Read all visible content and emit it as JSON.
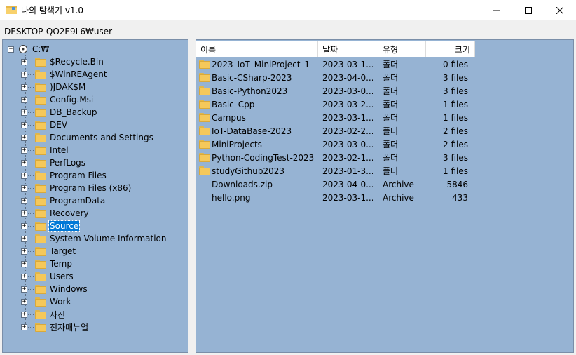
{
  "window": {
    "title": "나의 탐색기 v1.0",
    "minimize": "─",
    "maximize": "☐",
    "close": "✕"
  },
  "path": "DESKTOP-QO2E9L6₩user",
  "tree": {
    "root": "C:₩",
    "items": [
      {
        "label": "$Recycle.Bin"
      },
      {
        "label": "$WinREAgent"
      },
      {
        "label": ")JDAK$M"
      },
      {
        "label": "Config.Msi"
      },
      {
        "label": "DB_Backup"
      },
      {
        "label": "DEV"
      },
      {
        "label": "Documents and Settings"
      },
      {
        "label": "Intel"
      },
      {
        "label": "PerfLogs"
      },
      {
        "label": "Program Files"
      },
      {
        "label": "Program Files (x86)"
      },
      {
        "label": "ProgramData"
      },
      {
        "label": "Recovery"
      },
      {
        "label": "Source"
      },
      {
        "label": "System Volume Information"
      },
      {
        "label": "Target"
      },
      {
        "label": "Temp"
      },
      {
        "label": "Users"
      },
      {
        "label": "Windows"
      },
      {
        "label": "Work"
      },
      {
        "label": "사진"
      },
      {
        "label": "전자매뉴얼"
      }
    ],
    "selected": "Source"
  },
  "list": {
    "headers": {
      "name": "이름",
      "date": "날짜",
      "type": "유형",
      "size": "크기"
    },
    "rows": [
      {
        "name": "2023_IoT_MiniProject_1",
        "date": "2023-03-1...",
        "type": "폴더",
        "size": "0 files",
        "folder": true
      },
      {
        "name": "Basic-CSharp-2023",
        "date": "2023-04-0...",
        "type": "폴더",
        "size": "3 files",
        "folder": true
      },
      {
        "name": "Basic-Python2023",
        "date": "2023-03-0...",
        "type": "폴더",
        "size": "3 files",
        "folder": true
      },
      {
        "name": "Basic_Cpp",
        "date": "2023-03-2...",
        "type": "폴더",
        "size": "1 files",
        "folder": true
      },
      {
        "name": "Campus",
        "date": "2023-03-1...",
        "type": "폴더",
        "size": "1 files",
        "folder": true
      },
      {
        "name": "IoT-DataBase-2023",
        "date": "2023-02-2...",
        "type": "폴더",
        "size": "2 files",
        "folder": true
      },
      {
        "name": "MiniProjects",
        "date": "2023-03-0...",
        "type": "폴더",
        "size": "2 files",
        "folder": true
      },
      {
        "name": "Python-CodingTest-2023",
        "date": "2023-02-1...",
        "type": "폴더",
        "size": "3 files",
        "folder": true
      },
      {
        "name": "studyGithub2023",
        "date": "2023-01-3...",
        "type": "폴더",
        "size": "1 files",
        "folder": true
      },
      {
        "name": "Downloads.zip",
        "date": "2023-04-0...",
        "type": "Archive",
        "size": "5846",
        "folder": false
      },
      {
        "name": "hello.png",
        "date": "2023-03-1...",
        "type": "Archive",
        "size": "433",
        "folder": false
      }
    ]
  },
  "colors": {
    "panel_bg": "#96b3d3",
    "selection": "#0078d7",
    "folder": "#f5c85a"
  }
}
